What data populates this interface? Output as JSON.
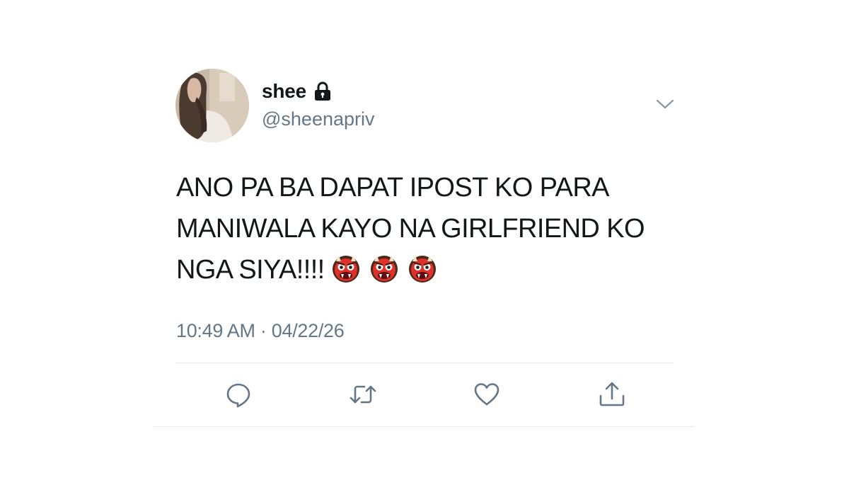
{
  "tweet": {
    "display_name": "shee",
    "handle": "@sheenapriv",
    "text": "ANO PA BA DAPAT IPOST KO PARA MANIWALA KAYO NA GIRLFRIEND KO NGA SIYA!!!!",
    "emojis": [
      "japanese-ogre-emoji",
      "japanese-ogre-emoji",
      "japanese-ogre-emoji"
    ],
    "timestamp": "10:49 AM · 04/22/26",
    "protected": true
  },
  "icons": {
    "lock": "lock-icon",
    "menu": "chevron-down-icon",
    "reply": "reply-icon",
    "retweet": "retweet-icon",
    "like": "heart-icon",
    "share": "share-icon"
  },
  "colors": {
    "text_primary": "#14171a",
    "text_secondary": "#657786",
    "divider": "#e1e8ed",
    "icon": "#657786"
  }
}
